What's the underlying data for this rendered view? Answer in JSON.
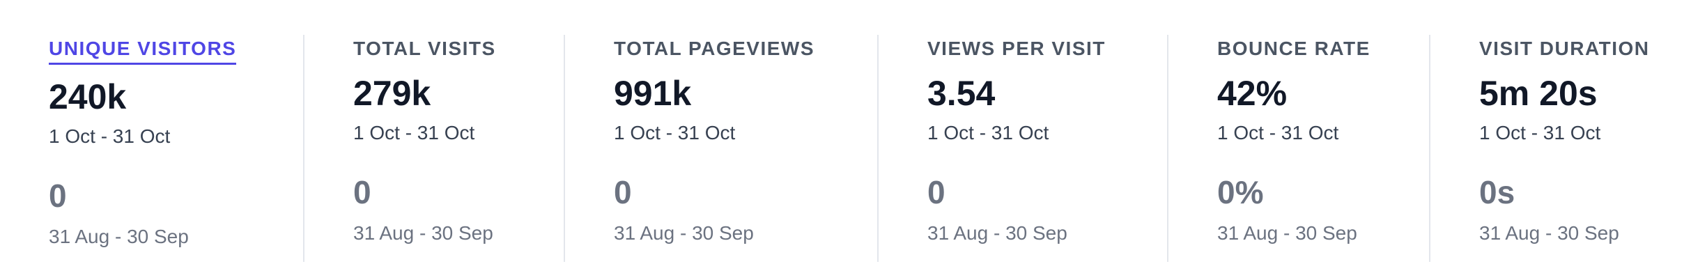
{
  "metrics": [
    {
      "label": "UNIQUE VISITORS",
      "value": "240k",
      "range": "1 Oct - 31 Oct",
      "comparison_value": "0",
      "comparison_range": "31 Aug - 30 Sep",
      "active": true
    },
    {
      "label": "TOTAL VISITS",
      "value": "279k",
      "range": "1 Oct - 31 Oct",
      "comparison_value": "0",
      "comparison_range": "31 Aug - 30 Sep",
      "active": false
    },
    {
      "label": "TOTAL PAGEVIEWS",
      "value": "991k",
      "range": "1 Oct - 31 Oct",
      "comparison_value": "0",
      "comparison_range": "31 Aug - 30 Sep",
      "active": false
    },
    {
      "label": "VIEWS PER VISIT",
      "value": "3.54",
      "range": "1 Oct - 31 Oct",
      "comparison_value": "0",
      "comparison_range": "31 Aug - 30 Sep",
      "active": false
    },
    {
      "label": "BOUNCE RATE",
      "value": "42%",
      "range": "1 Oct - 31 Oct",
      "comparison_value": "0%",
      "comparison_range": "31 Aug - 30 Sep",
      "active": false
    },
    {
      "label": "VISIT DURATION",
      "value": "5m 20s",
      "range": "1 Oct - 31 Oct",
      "comparison_value": "0s",
      "comparison_range": "31 Aug - 30 Sep",
      "active": false
    }
  ],
  "colors": {
    "accent": "#4f46e5",
    "label": "#4b5563",
    "value": "#111827",
    "muted": "#6b7280",
    "divider": "#e3e6ec"
  }
}
